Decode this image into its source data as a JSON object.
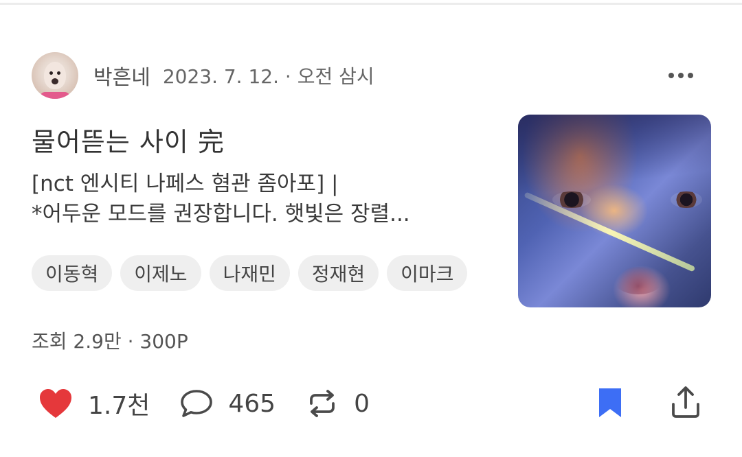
{
  "post": {
    "author": "박흔네",
    "meta": "2023. 7. 12. · 오전 삼시",
    "title": "물어뜯는 사이 完",
    "description_line1": "[nct 엔시티 나페스 혐관 좀아포] |",
    "description_line2": "*어두운 모드를 권장합니다. 햇빛은 장렬...",
    "tags": [
      "이동혁",
      "이제노",
      "나재민",
      "정재현",
      "이마크"
    ],
    "stats": "조회 2.9만 · 300P"
  },
  "actions": {
    "likes": "1.7천",
    "comments": "465",
    "reposts": "0"
  },
  "icons": {
    "like": "heart-icon",
    "comment": "comment-bubble-icon",
    "repost": "repost-icon",
    "bookmark": "bookmark-icon",
    "share": "share-icon",
    "more": "more-dots-icon"
  },
  "colors": {
    "heart": "#e5383b",
    "bookmark": "#3d6ef5",
    "tag_bg": "#efefef"
  }
}
